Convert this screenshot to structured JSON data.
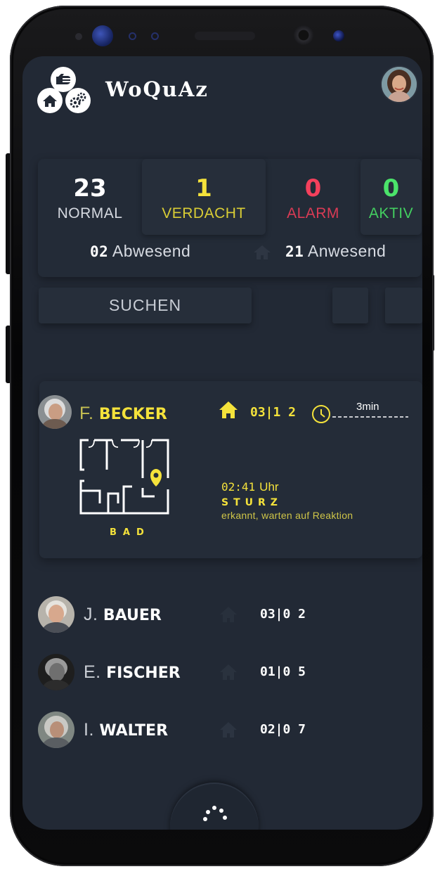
{
  "app": {
    "title": "WoQuAz"
  },
  "icons": {
    "logo": [
      "hand-icon",
      "home-icon",
      "gears-icon"
    ],
    "user_avatar": "user-avatar",
    "home": "home-icon",
    "clock": "clock-icon",
    "location": "location-pin-icon",
    "menu": "dots-arc-icon"
  },
  "colors": {
    "background": "#222935",
    "normal": "#ffffff",
    "verdacht": "#f4e23b",
    "alarm": "#f4405c",
    "aktiv": "#4be36a",
    "highlight": "#f4e23b"
  },
  "stats": {
    "normal": {
      "value": "23",
      "label": "NORMAL"
    },
    "verdacht": {
      "value": "1",
      "label": "VERDACHT"
    },
    "alarm": {
      "value": "0",
      "label": "ALARM"
    },
    "aktiv": {
      "value": "0",
      "label": "AKTIV"
    },
    "abwesend": {
      "value": "02",
      "label": "Abwesend"
    },
    "anwesend": {
      "value": "21",
      "label": "Anwesend"
    }
  },
  "search": {
    "label": "SUCHEN"
  },
  "alert": {
    "initial": "F.",
    "last_name": "BECKER",
    "room": "03|1 2",
    "timer": "3min",
    "room_name": "BAD",
    "event_time": "02:41",
    "event_time_unit": "Uhr",
    "event_type": "STURZ",
    "event_desc": "erkannt, warten auf Reaktion"
  },
  "residents": [
    {
      "initial": "J.",
      "last_name": "BAUER",
      "room": "03|0 2"
    },
    {
      "initial": "E.",
      "last_name": "FISCHER",
      "room": "01|0 5"
    },
    {
      "initial": "I.",
      "last_name": "WALTER",
      "room": "02|0 7"
    }
  ]
}
